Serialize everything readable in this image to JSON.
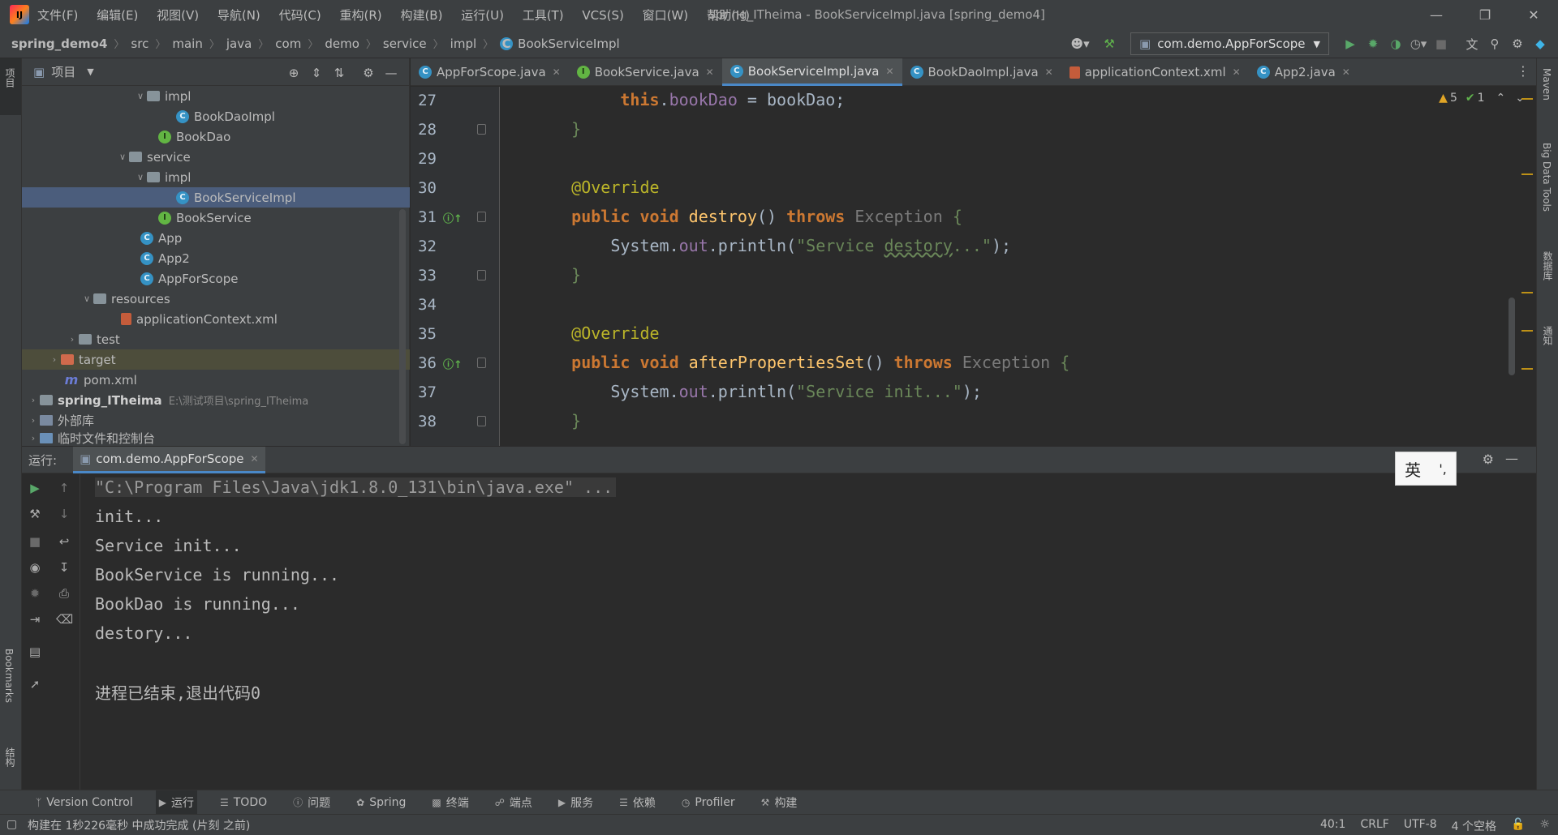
{
  "titlebar": {
    "menu": [
      "文件(F)",
      "编辑(E)",
      "视图(V)",
      "导航(N)",
      "代码(C)",
      "重构(R)",
      "构建(B)",
      "运行(U)",
      "工具(T)",
      "VCS(S)",
      "窗口(W)",
      "帮助(H)"
    ],
    "window_title": "spring_ITheima - BookServiceImpl.java [spring_demo4]"
  },
  "navbar": {
    "breadcrumbs": [
      "spring_demo4",
      "src",
      "main",
      "java",
      "com",
      "demo",
      "service",
      "impl",
      "BookServiceImpl"
    ],
    "run_config": "com.demo.AppForScope"
  },
  "left_stripe": {
    "project": "项目",
    "bookmarks": "Bookmarks",
    "structure": "结构"
  },
  "right_stripe": {
    "maven": "Maven",
    "bigdata": "Big Data Tools",
    "database": "数据库",
    "notifications": "通知"
  },
  "project_panel": {
    "title": "项目",
    "tree": [
      {
        "label": "impl",
        "type": "folder",
        "depth": 6,
        "expanded": true
      },
      {
        "label": "BookDaoImpl",
        "type": "class",
        "depth": 8
      },
      {
        "label": "BookDao",
        "type": "interface",
        "depth": 7
      },
      {
        "label": "service",
        "type": "folder",
        "depth": 5,
        "expanded": true
      },
      {
        "label": "impl",
        "type": "folder",
        "depth": 6,
        "expanded": true
      },
      {
        "label": "BookServiceImpl",
        "type": "class",
        "depth": 8,
        "selected": true
      },
      {
        "label": "BookService",
        "type": "interface",
        "depth": 7
      },
      {
        "label": "App",
        "type": "class",
        "depth": 6
      },
      {
        "label": "App2",
        "type": "class",
        "depth": 6
      },
      {
        "label": "AppForScope",
        "type": "class",
        "depth": 6
      },
      {
        "label": "resources",
        "type": "folder",
        "depth": 4,
        "expanded": true
      },
      {
        "label": "applicationContext.xml",
        "type": "xml",
        "depth": 5
      },
      {
        "label": "test",
        "type": "folder",
        "depth": 3,
        "collapsed": true
      },
      {
        "label": "target",
        "type": "target",
        "depth": 2,
        "collapsed": true
      },
      {
        "label": "pom.xml",
        "type": "maven",
        "depth": 2
      },
      {
        "label": "spring_ITheima",
        "type": "module",
        "depth": 1,
        "collapsed": true,
        "hint": "E:\\测试项目\\spring_ITheima"
      },
      {
        "label": "外部库",
        "type": "lib",
        "depth": 1,
        "collapsed": true
      },
      {
        "label": "临时文件和控制台",
        "type": "scratch",
        "depth": 1,
        "collapsed": true
      }
    ]
  },
  "editor": {
    "tabs": [
      {
        "label": "AppForScope.java",
        "icon": "C"
      },
      {
        "label": "BookService.java",
        "icon": "I"
      },
      {
        "label": "BookServiceImpl.java",
        "icon": "C",
        "active": true
      },
      {
        "label": "BookDaoImpl.java",
        "icon": "C"
      },
      {
        "label": "applicationContext.xml",
        "icon": "xml"
      },
      {
        "label": "App2.java",
        "icon": "C"
      }
    ],
    "warnings": "5",
    "checks": "1",
    "line_numbers": [
      "27",
      "28",
      "29",
      "30",
      "31",
      "32",
      "33",
      "34",
      "35",
      "36",
      "37",
      "38"
    ]
  },
  "run_panel": {
    "label": "运行:",
    "tab": "com.demo.AppForScope",
    "console": [
      "\"C:\\Program Files\\Java\\jdk1.8.0_131\\bin\\java.exe\" ...",
      "init...",
      "Service init...",
      "BookService is running...",
      "BookDao is running...",
      "destory...",
      "",
      "进程已结束,退出代码0"
    ]
  },
  "ime": {
    "lang": "英",
    "punct": "',"
  },
  "bottom_bar": [
    "Version Control",
    "运行",
    "TODO",
    "问题",
    "Spring",
    "终端",
    "端点",
    "服务",
    "依赖",
    "Profiler",
    "构建"
  ],
  "status_bar": {
    "message": "构建在 1秒226毫秒 中成功完成 (片刻 之前)",
    "position": "40:1",
    "line_sep": "CRLF",
    "encoding": "UTF-8",
    "indent": "4 个空格"
  }
}
